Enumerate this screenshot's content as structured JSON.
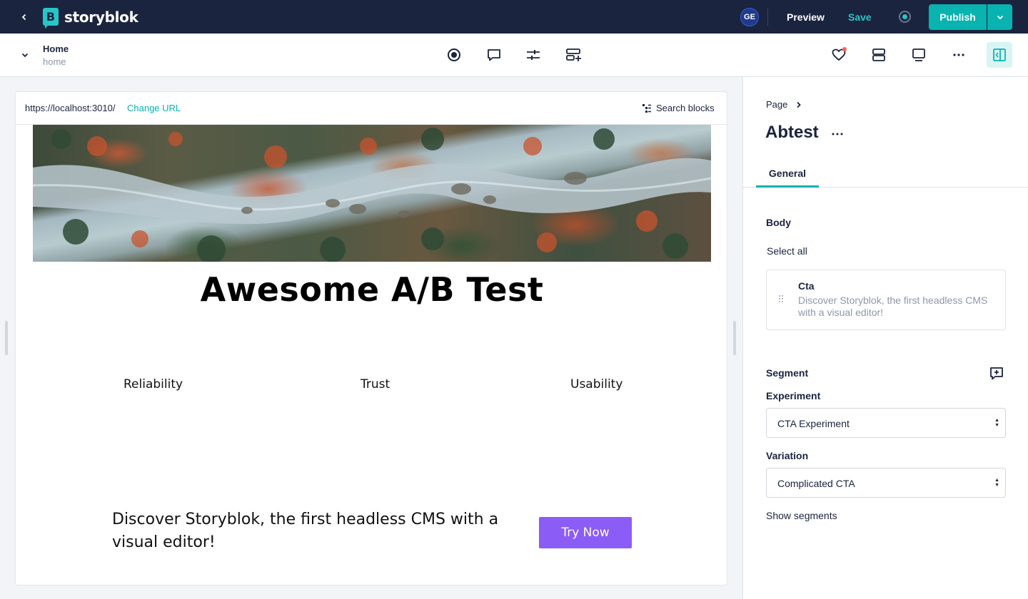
{
  "app": {
    "logo_text": "storyblok",
    "logo_letter": "B",
    "user_initials": "GE",
    "preview_label": "Preview",
    "save_label": "Save",
    "publish_label": "Publish",
    "accent_color": "#09b3af",
    "topbar_color": "#1b243f"
  },
  "story": {
    "name": "Home",
    "slug": "home"
  },
  "toolbar": {
    "center_icons": [
      "record-icon",
      "comment-icon",
      "sliders-icon",
      "add-block-icon"
    ],
    "right_icons": [
      "heart-icon",
      "layout-icon",
      "monitor-icon",
      "more-icon",
      "side-panel-icon"
    ]
  },
  "preview": {
    "url": "https://localhost:3010/",
    "change_url_label": "Change URL",
    "search_blocks_label": "Search blocks",
    "heading": "Awesome A/B Test",
    "features": [
      "Reliability",
      "Trust",
      "Usability"
    ],
    "cta_text": "Discover Storyblok, the first headless CMS with a visual editor!",
    "cta_button": "Try Now",
    "cta_button_color": "#8b5cf6"
  },
  "panel": {
    "breadcrumb": "Page",
    "title": "Abtest",
    "tab_general": "General",
    "body_label": "Body",
    "select_all": "Select all",
    "block": {
      "title": "Cta",
      "description": "Discover Storyblok, the first headless CMS with a visual editor!"
    },
    "segment_label": "Segment",
    "experiment_label": "Experiment",
    "experiment_value": "CTA Experiment",
    "variation_label": "Variation",
    "variation_value": "Complicated CTA",
    "show_segments": "Show segments"
  }
}
